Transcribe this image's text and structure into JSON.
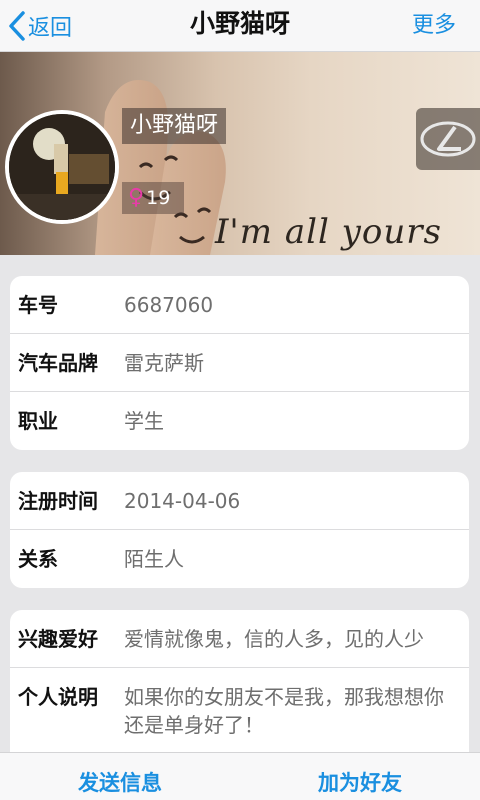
{
  "nav": {
    "back_label": "返回",
    "title": "小野猫呀",
    "more_label": "更多"
  },
  "profile": {
    "name": "小野猫呀",
    "age": "19",
    "gender_symbol": "♀",
    "banner_text": "I'm all yours"
  },
  "group1": {
    "rows": [
      {
        "label": "车号",
        "value": "6687060"
      },
      {
        "label": "汽车品牌",
        "value": "雷克萨斯"
      },
      {
        "label": "职业",
        "value": "学生"
      }
    ]
  },
  "group2": {
    "rows": [
      {
        "label": "注册时间",
        "value": "2014-04-06"
      },
      {
        "label": "关系",
        "value": "陌生人"
      }
    ]
  },
  "group3": {
    "rows": [
      {
        "label": "兴趣爱好",
        "value": "爱情就像鬼，信的人多，见的人少"
      },
      {
        "label": "个人说明",
        "value": "如果你的女朋友不是我，那我想想你还是单身好了！"
      }
    ]
  },
  "actions": {
    "send_message": "发送信息",
    "add_friend": "加为好友"
  },
  "colors": {
    "accent": "#1a8fe0",
    "female": "#e83ca8"
  },
  "icons": {
    "back": "chevron-left-icon",
    "gender": "female-icon",
    "brand": "lexus-logo-icon"
  }
}
